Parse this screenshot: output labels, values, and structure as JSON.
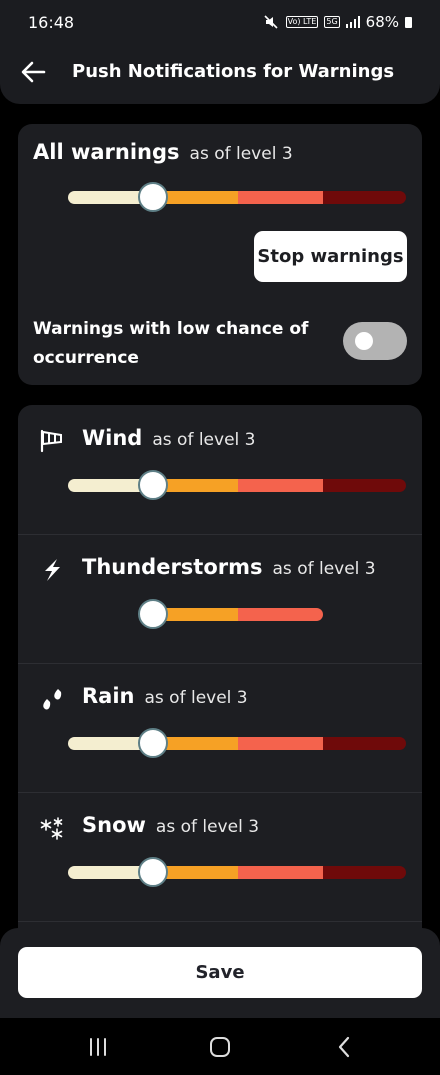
{
  "status_bar": {
    "time": "16:48",
    "signal_text": "Vo) LTE",
    "network": "5G",
    "battery": "68%"
  },
  "app_bar": {
    "title": "Push Notifications for Warnings"
  },
  "all_warnings": {
    "title": "All warnings",
    "level_text": "as of level 3",
    "level": 2,
    "stop_label": "Stop warnings",
    "low_chance_label": "Warnings with low chance of occurrence",
    "low_chance_enabled": false
  },
  "categories": [
    {
      "name": "Wind",
      "level_text": "as of level 3",
      "icon": "windsock-icon"
    },
    {
      "name": "Thunderstorms",
      "level_text": "as of level 3",
      "icon": "lightning-icon"
    },
    {
      "name": "Rain",
      "level_text": "as of level 3",
      "icon": "rain-drops-icon"
    },
    {
      "name": "Snow",
      "level_text": "as of level 3",
      "icon": "snowflake-icon"
    }
  ],
  "colors": {
    "level1": "#f4eed0",
    "level2": "#f6a125",
    "level3": "#f4634d",
    "level4": "#6f0a0a",
    "card": "#1d1e22"
  },
  "footer": {
    "save_label": "Save"
  }
}
